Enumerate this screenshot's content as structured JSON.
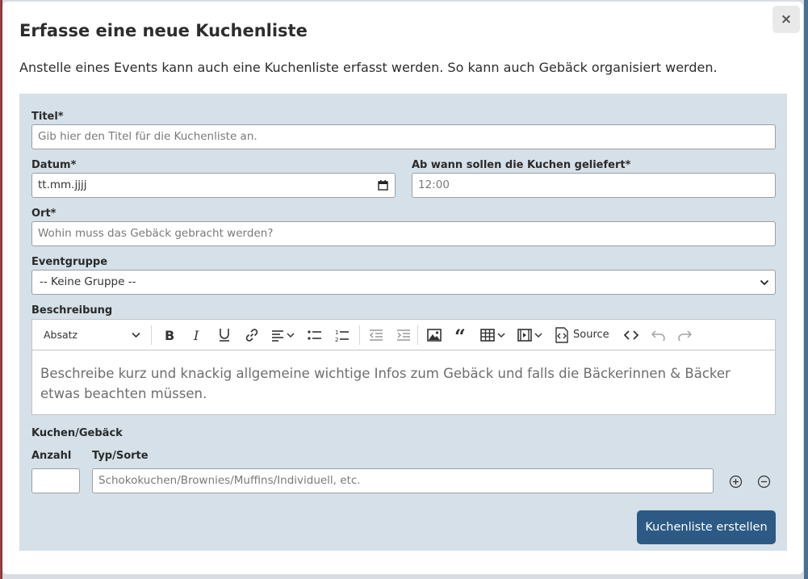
{
  "modal": {
    "close_label": "×",
    "title": "Erfasse eine neue Kuchenliste",
    "intro": "Anstelle eines Events kann auch eine Kuchenliste erfasst werden. So kann auch Gebäck organisiert werden."
  },
  "form": {
    "title_label": "Titel*",
    "title_placeholder": "Gib hier den Titel für die Kuchenliste an.",
    "date_label": "Datum*",
    "date_value": "tt.mm.jjjj",
    "time_label": "Ab wann sollen die Kuchen geliefert*",
    "time_placeholder": "12:00",
    "location_label": "Ort*",
    "location_placeholder": "Wohin muss das Gebäck gebracht werden?",
    "group_label": "Eventgruppe",
    "group_value": "-- Keine Gruppe --",
    "description_label": "Beschreibung",
    "cakes_label": "Kuchen/Gebäck",
    "count_label": "Anzahl",
    "count_value": "",
    "type_label": "Typ/Sorte",
    "type_placeholder": "Schokokuchen/Brownies/Muffins/Individuell, etc.",
    "submit_label": "Kuchenliste erstellen"
  },
  "editor": {
    "heading_select": "Absatz",
    "source_label": "Source",
    "placeholder": "Beschreibe kurz und knackig allgemeine wichtige Infos zum Gebäck und falls die Bäckerinnen & Bäcker etwas beachten müssen.",
    "toolbar_icons": [
      "bold-icon",
      "italic-icon",
      "underline-icon",
      "link-icon",
      "align-icon",
      "bulleted-list-icon",
      "numbered-list-icon",
      "outdent-icon",
      "indent-icon",
      "image-icon",
      "blockquote-icon",
      "table-icon",
      "media-icon",
      "source-icon",
      "code-icon",
      "undo-icon",
      "redo-icon"
    ]
  },
  "colors": {
    "panel_bg": "#d5e0e8",
    "primary_button": "#2c5a85"
  }
}
